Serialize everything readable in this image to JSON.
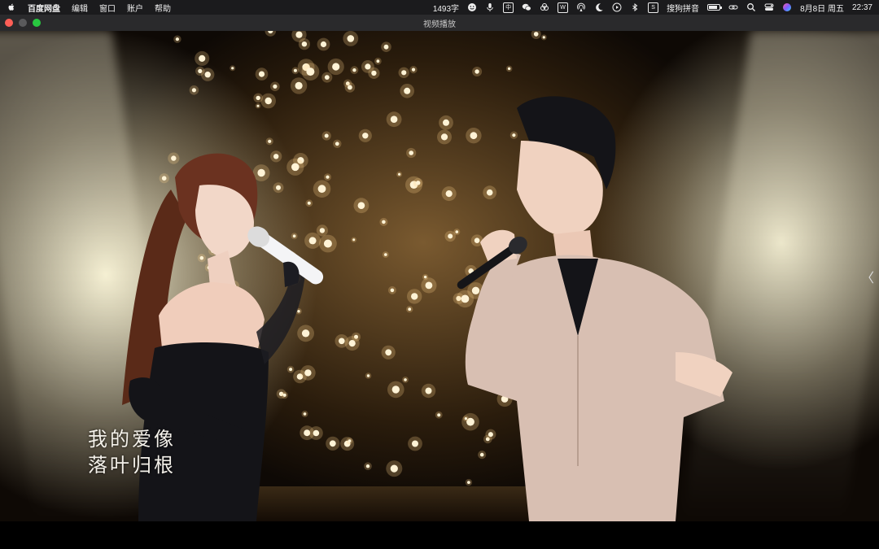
{
  "menubar": {
    "app_name": "百度网盘",
    "menus": [
      "编辑",
      "窗口",
      "账户",
      "帮助"
    ],
    "word_count": "1493字",
    "input_method_badge": "中",
    "input_method": "搜狗拼音",
    "date": "8月8日 周五",
    "time": "22:37",
    "battery_level": 0.8,
    "icons": [
      "apple-icon",
      "emoji-icon",
      "microphone-icon",
      "wechat-icon",
      "cloud-icon",
      "w-icon",
      "airdrop-icon",
      "moon-icon",
      "play-icon",
      "bluetooth-icon",
      "sogou-icon",
      "battery-icon",
      "link-icon",
      "search-icon",
      "control-center-icon",
      "siri-icon"
    ]
  },
  "window": {
    "title": "视频播放"
  },
  "player": {
    "lyrics_line1": "我的爱像",
    "lyrics_line2": "落叶归根",
    "side_arrow": "〈"
  },
  "colors": {
    "close": "#ff5f57",
    "minimize": "#5a5a5c",
    "maximize": "#28c840",
    "suit": "#d8bfb2",
    "dress": "#141418"
  }
}
